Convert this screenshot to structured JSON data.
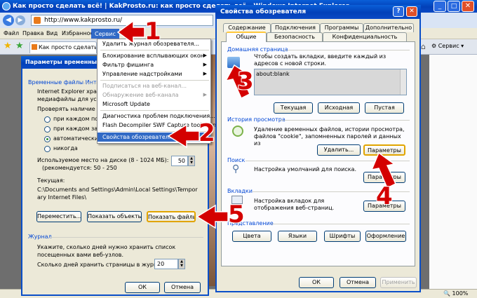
{
  "browser": {
    "title": "Как просто сделать всё! | KakProsto.ru: как просто сделать всё - Windows Internet Explorer",
    "address": "http://www.kakprosto.ru/",
    "menu": [
      "Файл",
      "Правка",
      "Вид",
      "Избранное",
      "Сервис"
    ],
    "tab_label": "Как просто сделать...",
    "service_label": "Сервис",
    "status": "100%"
  },
  "service_menu": {
    "items": [
      {
        "label": "Удалить журнал обозревателя...",
        "state": "normal"
      },
      {
        "label": "Блокирование всплывающих окон",
        "state": "normal",
        "sub": true
      },
      {
        "label": "Фильтр фишинга",
        "state": "normal",
        "sub": true
      },
      {
        "label": "Управление надстройками",
        "state": "normal",
        "sub": true
      },
      {
        "label": "Подписаться на веб-канал...",
        "state": "disabled"
      },
      {
        "label": "Обнаружение веб-канала",
        "state": "disabled",
        "sub": true
      },
      {
        "label": "Microsoft Update",
        "state": "normal"
      },
      {
        "label": "Диагностика проблем подключения...",
        "state": "normal"
      },
      {
        "label": "Flash Decompiler SWF Capture tool menu",
        "state": "normal"
      },
      {
        "label": "Свойства обозревателя",
        "state": "selected"
      }
    ]
  },
  "temp_dialog": {
    "title": "Параметры временных ф",
    "group_temp": "Временные файлы Инте",
    "desc1": "Internet Explorer храни",
    "desc2": "медиафайлы для ускор",
    "check_label": "Проверять наличие об",
    "radios": [
      "при каждом пос",
      "при каждом зап",
      "автоматически",
      "никогда"
    ],
    "disk_label": "Используемое место на диске (8 - 1024 МБ):",
    "disk_recommend": "(рекомендуется: 50 - 250",
    "disk_value": "50",
    "current_label": "Текущая:",
    "current_path": "C:\\Documents and Settings\\Admin\\Local Settings\\Temporary Internet Files\\",
    "btn_move": "Переместить...",
    "btn_objects": "Показать объекты",
    "btn_files": "Показать файлы",
    "group_journal": "Журнал",
    "journal_desc": "Укажите, сколько дней нужно хранить список посещенных вами веб-узлов.",
    "days_label": "Сколько дней хранить страницы в журнале:",
    "days_value": "20",
    "btn_ok": "ОК",
    "btn_cancel": "Отмена"
  },
  "props_dialog": {
    "title": "Свойства обозревателя",
    "tabs_back": [
      "Содержание",
      "Подключения",
      "Программы",
      "Дополнительно"
    ],
    "tabs_front": [
      "Общие",
      "Безопасность",
      "Конфиденциальность"
    ],
    "home_group": "Домашняя страница",
    "home_desc": "Чтобы создать вкладки, введите каждый из адресов с новой строки.",
    "home_value": "about:blank",
    "btn_current": "Текущая",
    "btn_default": "Исходная",
    "btn_blank": "Пустая",
    "history_group": "История просмотра",
    "history_desc": "Удаление временных файлов, истории просмотра, файлов \"cookie\", запомненных паролей и данных из",
    "btn_delete": "Удалить...",
    "btn_params1": "Параметры",
    "search_group": "Поиск",
    "search_desc": "Настройка умолчаний для поиска.",
    "btn_params2": "Параметры",
    "tabs_group": "Вкладки",
    "tabs_desc": "Настройка вкладок для отображения веб-страниц.",
    "btn_params3": "Параметры",
    "appearance_group": "Представление",
    "btn_colors": "Цвета",
    "btn_langs": "Языки",
    "btn_fonts": "Шрифты",
    "btn_design": "Оформление",
    "btn_ok": "ОК",
    "btn_cancel": "Отмена",
    "btn_apply": "Применить"
  },
  "steps": [
    "1",
    "2",
    "3",
    "4",
    "5"
  ],
  "colors": {
    "accent": "#d40000",
    "xp_blue": "#0a4fc8",
    "dialog_bg": "#ece9d8",
    "group_text": "#0046d5"
  }
}
